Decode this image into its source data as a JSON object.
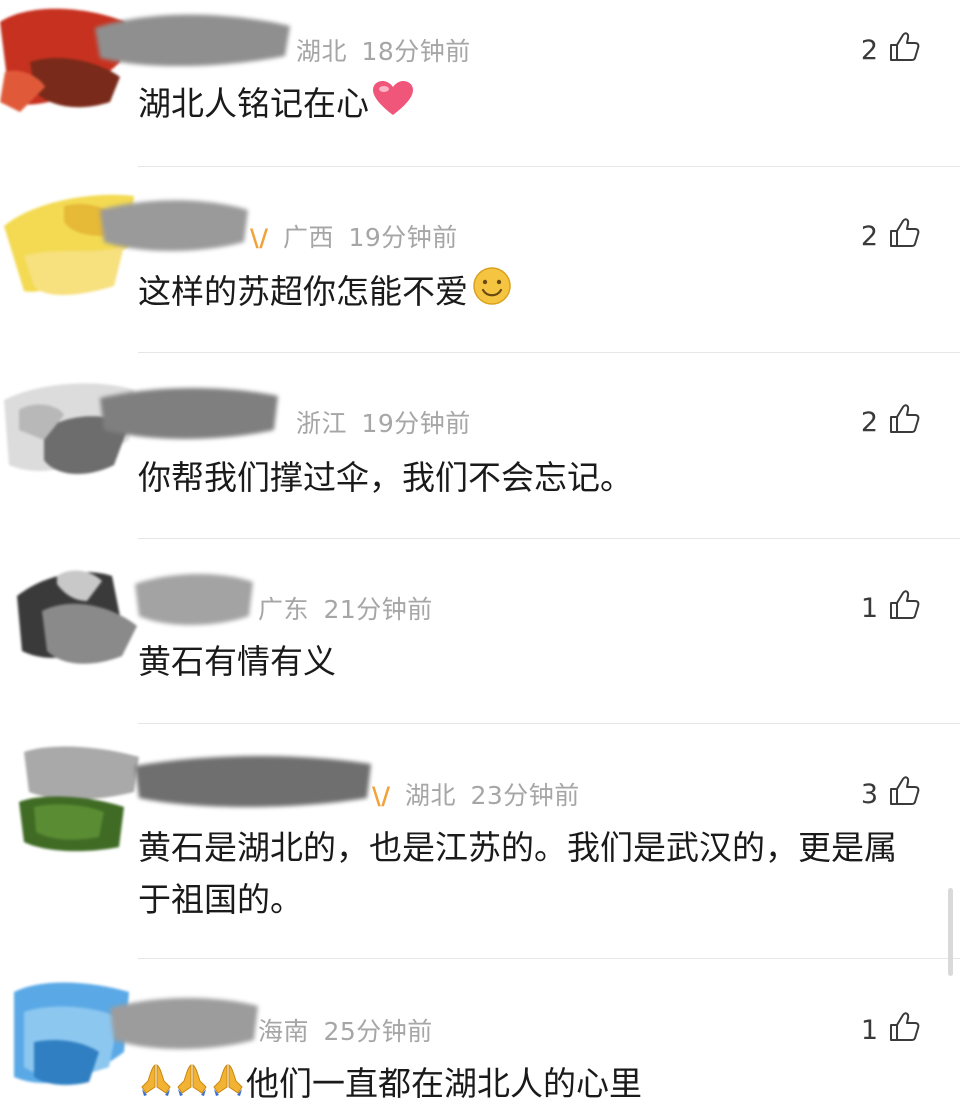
{
  "comments": [
    {
      "region": "湖北",
      "time": "18分钟前",
      "likes": "2",
      "text": "湖北人铭记在心",
      "emoji": "heart",
      "medal": false
    },
    {
      "region": "广西",
      "time": "19分钟前",
      "likes": "2",
      "text": "这样的苏超你怎能不爱",
      "emoji": "smile",
      "medal": true
    },
    {
      "region": "浙江",
      "time": "19分钟前",
      "likes": "2",
      "text": "你帮我们撑过伞，我们不会忘记。",
      "emoji": "",
      "medal": false
    },
    {
      "region": "广东",
      "time": "21分钟前",
      "likes": "1",
      "text": "黄石有情有义",
      "emoji": "",
      "medal": false
    },
    {
      "region": "湖北",
      "time": "23分钟前",
      "likes": "3",
      "text": "黄石是湖北的，也是江苏的。我们是武汉的，更是属于祖国的。",
      "emoji": "",
      "medal": true
    },
    {
      "region": "海南",
      "time": "25分钟前",
      "likes": "1",
      "text": "他们一直都在湖北人的心里",
      "emoji": "pray-x3",
      "medal": false
    }
  ],
  "colors": {
    "meta": "#a6a6a6",
    "text": "#1a1a1a",
    "divider": "#e6e6e6",
    "heart": "#f0557a",
    "smile": "#f5c542",
    "pray": "#f2b233"
  },
  "icons": {
    "like": "thumbs-up-icon",
    "medal": "badge-icon"
  }
}
